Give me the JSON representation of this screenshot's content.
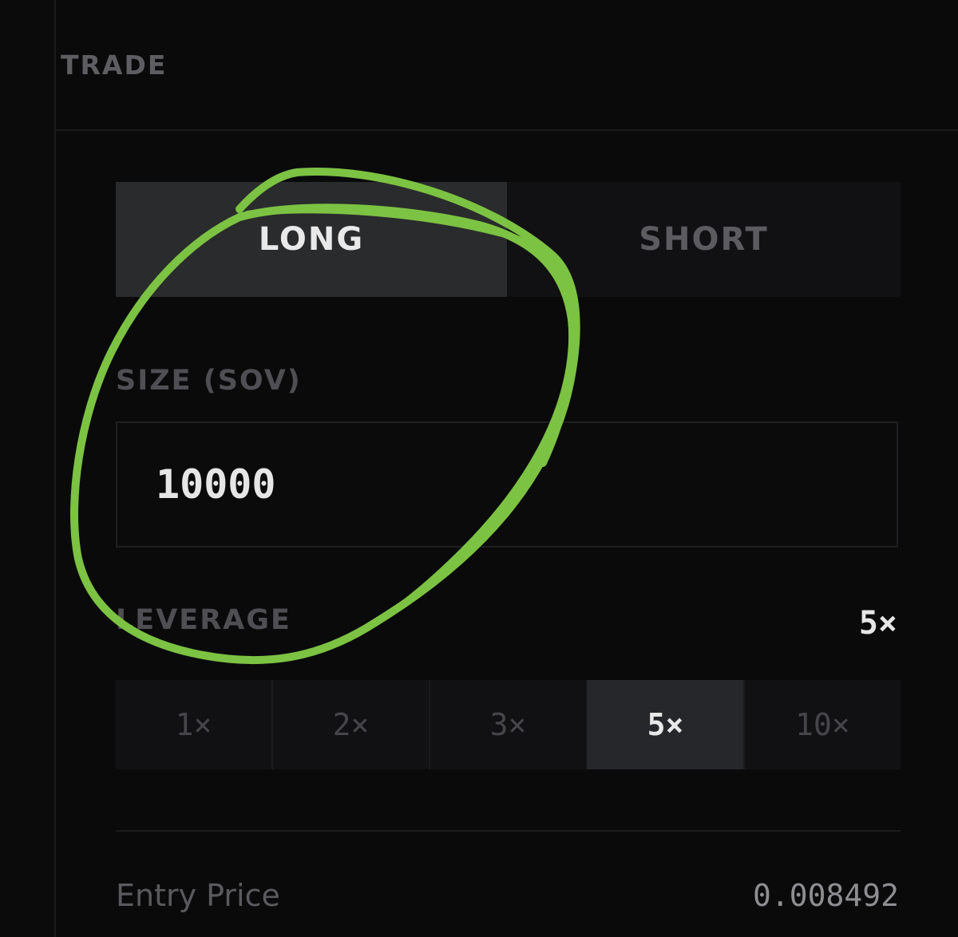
{
  "panel": {
    "title": "TRADE"
  },
  "side": {
    "long_label": "LONG",
    "short_label": "SHORT",
    "selected": "LONG"
  },
  "size": {
    "label": "SIZE (SOV)",
    "value": "10000"
  },
  "leverage": {
    "label": "LEVERAGE",
    "current": "5×",
    "options": [
      "1×",
      "2×",
      "3×",
      "5×",
      "10×"
    ],
    "selected": "5×"
  },
  "stats": {
    "entry_price_label": "Entry Price",
    "entry_price_value": "0.008492"
  },
  "annotation": {
    "color": "#7cc243"
  }
}
